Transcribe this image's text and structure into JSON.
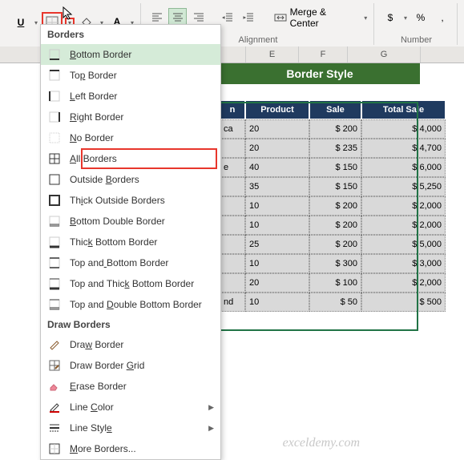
{
  "ribbon": {
    "underline": "U",
    "fontcolor": "A",
    "merge_label": "Merge & Center",
    "group_align": "Alignment",
    "group_num": "Number",
    "currency": "$",
    "percent": "%",
    "comma": ","
  },
  "dropdown": {
    "header1": "Borders",
    "items1": [
      {
        "label": "Bottom Border",
        "u": 0
      },
      {
        "label": "Top Border",
        "u": 2
      },
      {
        "label": "Left Border",
        "u": 0
      },
      {
        "label": "Right Border",
        "u": 0
      },
      {
        "label": "No Border",
        "u": 0
      },
      {
        "label": "All Borders",
        "u": 0
      },
      {
        "label": "Outside Borders",
        "u": 8
      },
      {
        "label": "Thick Outside Borders",
        "u": 2
      },
      {
        "label": "Bottom Double Border",
        "u": 0
      },
      {
        "label": "Thick Bottom Border",
        "u": 4
      },
      {
        "label": "Top and Bottom Border",
        "u": 7
      },
      {
        "label": "Top and Thick Bottom Border",
        "u": 12
      },
      {
        "label": "Top and Double Bottom Border",
        "u": 8
      }
    ],
    "header2": "Draw Borders",
    "items2": [
      {
        "label": "Draw Border",
        "u": 3
      },
      {
        "label": "Draw Border Grid",
        "u": 12
      },
      {
        "label": "Erase Border",
        "u": 0
      },
      {
        "label": "Line Color",
        "u": 5,
        "arrow": true
      },
      {
        "label": "Line Style",
        "u": 9,
        "arrow": true
      },
      {
        "label": "More Borders...",
        "u": 0
      }
    ]
  },
  "sheet": {
    "cols": [
      "E",
      "F",
      "G"
    ],
    "title": "Border Style",
    "headers": [
      "n",
      "Product",
      "Sale",
      "Total Sale"
    ],
    "rows": [
      [
        "ca",
        "20",
        "$   200",
        "$        4,000"
      ],
      [
        "",
        "20",
        "$   235",
        "$        4,700"
      ],
      [
        "e",
        "40",
        "$   150",
        "$        6,000"
      ],
      [
        "",
        "35",
        "$   150",
        "$        5,250"
      ],
      [
        "",
        "10",
        "$   200",
        "$        2,000"
      ],
      [
        "",
        "10",
        "$   200",
        "$        2,000"
      ],
      [
        "",
        "25",
        "$   200",
        "$        5,000"
      ],
      [
        "",
        "10",
        "$   300",
        "$        3,000"
      ],
      [
        "",
        "20",
        "$   100",
        "$        2,000"
      ],
      [
        "nd",
        "10",
        "$     50",
        "$           500"
      ]
    ]
  },
  "watermark": "exceldemy.com"
}
